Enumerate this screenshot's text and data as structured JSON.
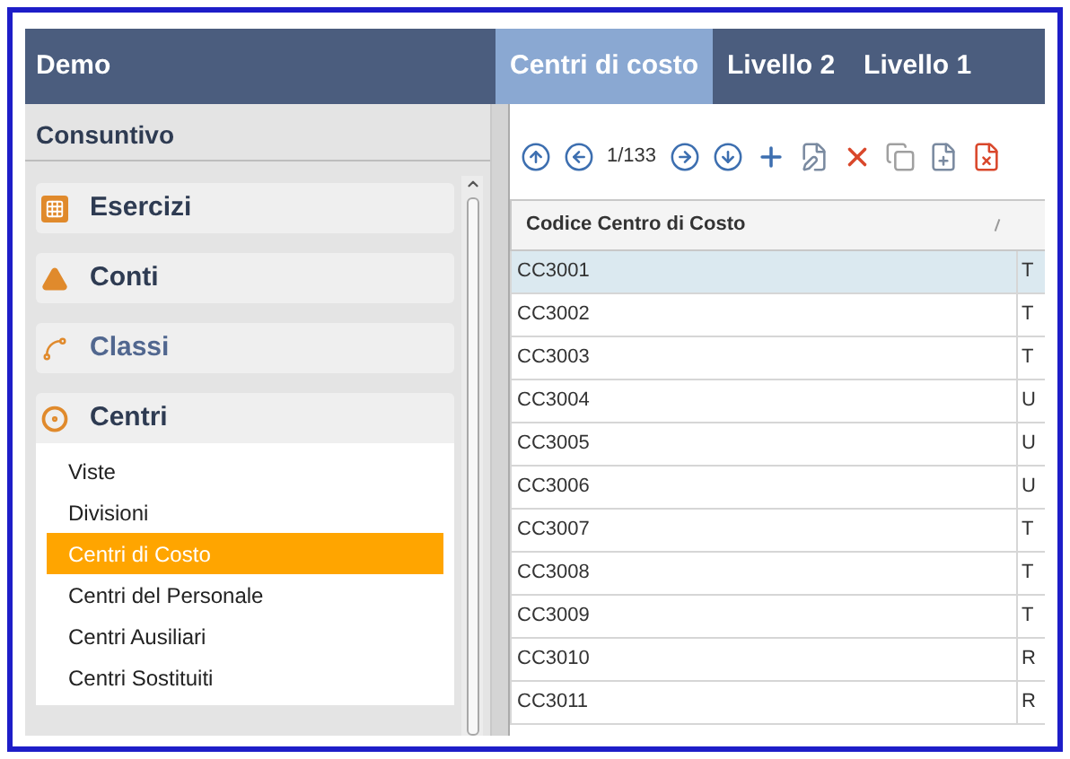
{
  "header": {
    "title": "Demo",
    "tabs": [
      {
        "label": "Centri di costo",
        "selected": true
      },
      {
        "label": "Livello 2",
        "selected": false
      },
      {
        "label": "Livello 1",
        "selected": false
      }
    ]
  },
  "sidebar": {
    "title": "Consuntivo",
    "sections": [
      {
        "label": "Esercizi",
        "kind": "grid",
        "highlighted": false,
        "expanded": false
      },
      {
        "label": "Conti",
        "kind": "levels",
        "highlighted": false,
        "expanded": false
      },
      {
        "label": "Classi",
        "kind": "link",
        "highlighted": true,
        "expanded": false
      },
      {
        "label": "Centri",
        "kind": "target",
        "highlighted": false,
        "expanded": true,
        "items": [
          {
            "label": "Viste",
            "selected": false
          },
          {
            "label": "Divisioni",
            "selected": false
          },
          {
            "label": "Centri di Costo",
            "selected": true
          },
          {
            "label": "Centri del Personale",
            "selected": false
          },
          {
            "label": "Centri Ausiliari",
            "selected": false
          },
          {
            "label": "Centri Sostituiti",
            "selected": false
          }
        ]
      }
    ]
  },
  "toolbar": {
    "position": "1/133"
  },
  "table": {
    "columns": [
      "Codice Centro di Costo"
    ],
    "rows": [
      {
        "code": "CC3001",
        "column_2": "T",
        "selected": true
      },
      {
        "code": "CC3002",
        "column_2": "T",
        "selected": false
      },
      {
        "code": "CC3003",
        "column_2": "T",
        "selected": false
      },
      {
        "code": "CC3004",
        "column_2": "U",
        "selected": false
      },
      {
        "code": "CC3005",
        "column_2": "U",
        "selected": false
      },
      {
        "code": "CC3006",
        "column_2": "U",
        "selected": false
      },
      {
        "code": "CC3007",
        "column_2": "T",
        "selected": false
      },
      {
        "code": "CC3008",
        "column_2": "T",
        "selected": false
      },
      {
        "code": "CC3009",
        "column_2": "T",
        "selected": false
      },
      {
        "code": "CC3010",
        "column_2": "R",
        "selected": false
      },
      {
        "code": "CC3011",
        "column_2": "R",
        "selected": false
      }
    ]
  }
}
